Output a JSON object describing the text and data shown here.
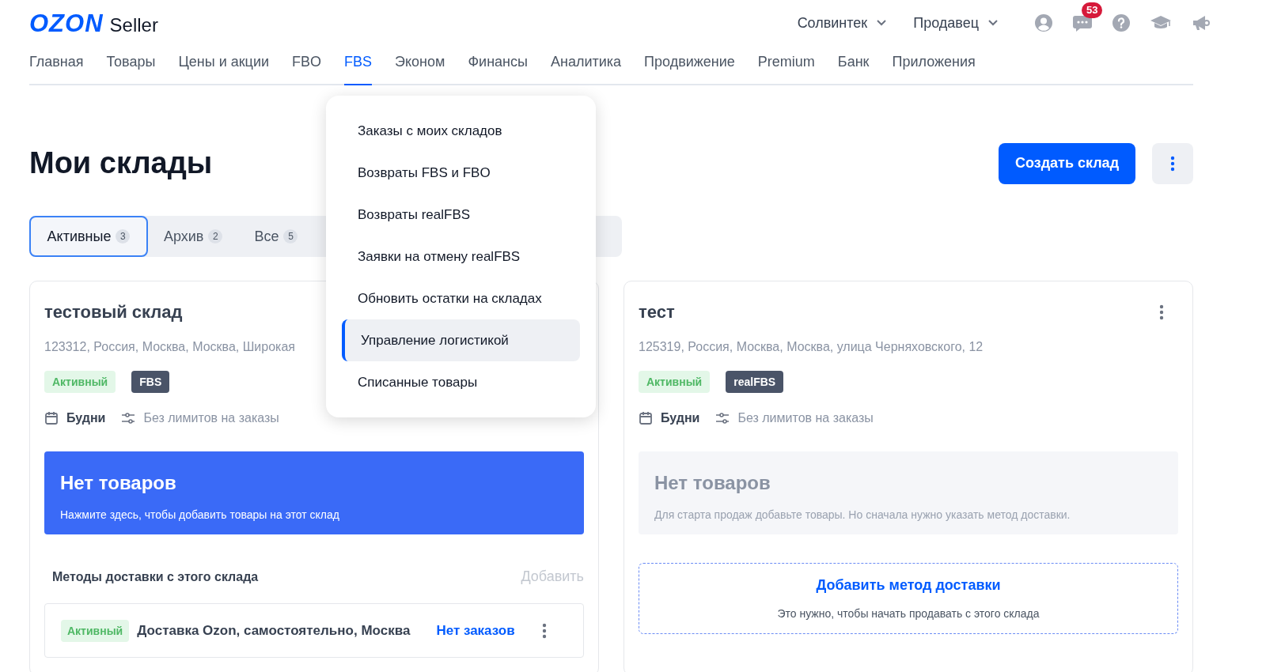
{
  "header": {
    "logo": "OZON",
    "logo_suffix": "Seller",
    "company": "Солвинтек",
    "role": "Продавец",
    "notifications": "53"
  },
  "nav": [
    {
      "label": "Главная",
      "selected": false
    },
    {
      "label": "Товары",
      "selected": false
    },
    {
      "label": "Цены и акции",
      "selected": false
    },
    {
      "label": "FBO",
      "selected": false
    },
    {
      "label": "FBS",
      "selected": true
    },
    {
      "label": "Эконом",
      "selected": false
    },
    {
      "label": "Финансы",
      "selected": false
    },
    {
      "label": "Аналитика",
      "selected": false
    },
    {
      "label": "Продвижение",
      "selected": false
    },
    {
      "label": "Premium",
      "selected": false
    },
    {
      "label": "Банк",
      "selected": false
    },
    {
      "label": "Приложения",
      "selected": false
    }
  ],
  "dropdown": [
    {
      "label": "Заказы с моих складов",
      "selected": false
    },
    {
      "label": "Возвраты FBS и FBO",
      "selected": false
    },
    {
      "label": "Возвраты realFBS",
      "selected": false
    },
    {
      "label": "Заявки на отмену realFBS",
      "selected": false
    },
    {
      "label": "Обновить остатки на складах",
      "selected": false
    },
    {
      "label": "Управление логистикой",
      "selected": true
    },
    {
      "label": "Списанные товары",
      "selected": false
    }
  ],
  "page_title": "Мои склады",
  "create_button": "Создать склад",
  "tabs": [
    {
      "label": "Активные",
      "count": "3",
      "selected": true
    },
    {
      "label": "Архив",
      "count": "2",
      "selected": false
    },
    {
      "label": "Все",
      "count": "5",
      "selected": false
    }
  ],
  "warehouses": [
    {
      "name": "тестовый склад",
      "address": "123312, Россия, Москва, Москва, Широкая",
      "status": "Активный",
      "scheme": "FBS",
      "schedule": "Будни",
      "limits": "Без лимитов на заказы",
      "products": {
        "kind": "action",
        "title": "Нет товаров",
        "text": "Нажмите здесь, чтобы добавить товары на этот склад"
      },
      "delivery_methods": {
        "title": "Методы доставки с этого склада",
        "add_label": "Добавить",
        "items": [
          {
            "status": "Активный",
            "name": "Доставка Ozon, самостоятельно, Москва",
            "orders": "Нет заказов"
          }
        ]
      }
    },
    {
      "name": "тест",
      "address": "125319, Россия, Москва, Москва, улица Черняховского, 12",
      "status": "Активный",
      "scheme": "realFBS",
      "schedule": "Будни",
      "limits": "Без лимитов на заказы",
      "products": {
        "kind": "muted",
        "title": "Нет товаров",
        "text": "Для старта продаж добавьте товары. Но сначала нужно указать метод доставки."
      },
      "add_delivery": {
        "title": "Добавить метод доставки",
        "text": "Это нужно, чтобы начать продавать с этого склада"
      }
    }
  ]
}
